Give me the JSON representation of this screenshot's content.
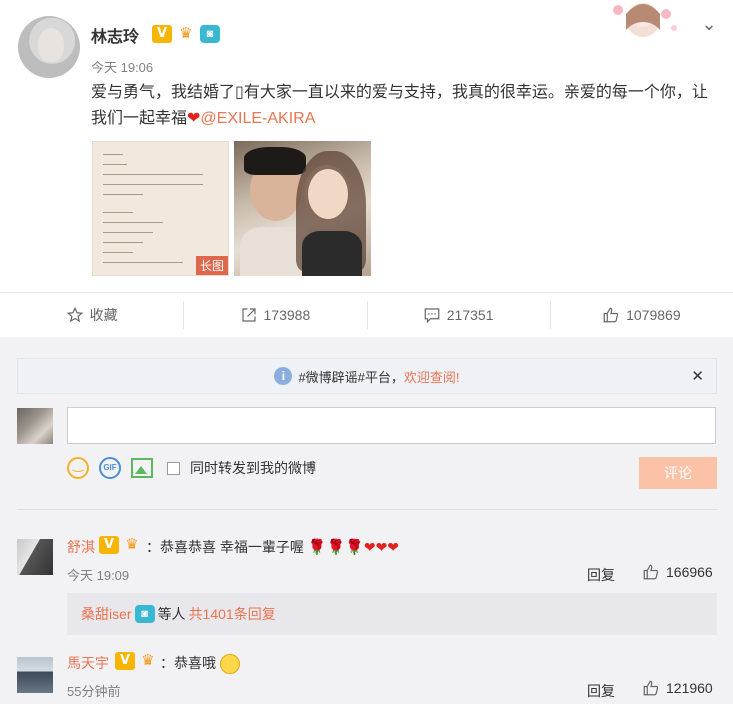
{
  "post": {
    "username": "林志玲",
    "time": "今天 19:06",
    "text_main": "爱与勇气，我结婚了",
    "text_box_char": "▯",
    "text_rest": "有大家一直以来的爱与支持，我真的很幸运。亲爱的每一个你，让我们一起幸福",
    "heart": "❤",
    "mention": "@EXILE-AKIRA",
    "thumb1_tag": "长图"
  },
  "actions": {
    "favorite_label": "收藏",
    "repost_count": "173988",
    "comment_count": "217351",
    "like_count": "1079869"
  },
  "notice": {
    "text_prefix": "#微博辟谣#平台，",
    "text_link": "欢迎查阅!",
    "close": "✕"
  },
  "composer": {
    "repost_label": "同时转发到我的微博",
    "submit_label": "评论"
  },
  "comments": [
    {
      "name": "舒淇",
      "text": "：恭喜恭喜 幸福一輩子喔",
      "time": "今天 19:09",
      "reply": "回复",
      "likes": "166966"
    },
    {
      "name": "馬天宇",
      "text": "：恭喜哦",
      "time": "55分钟前",
      "reply": "回复",
      "likes": "121960"
    }
  ],
  "sub_reply": {
    "name": "桑甜iser",
    "middle": "等人",
    "count": "共1401条回复"
  },
  "icons": {
    "verified": "V",
    "camera": "◙",
    "chevron": "⌄",
    "info": "i"
  },
  "colors": {
    "accent": "#eb7350",
    "verified": "#f7b500",
    "comment_btn": "#fbc2a7",
    "bg_comments": "#f2f2f5"
  }
}
